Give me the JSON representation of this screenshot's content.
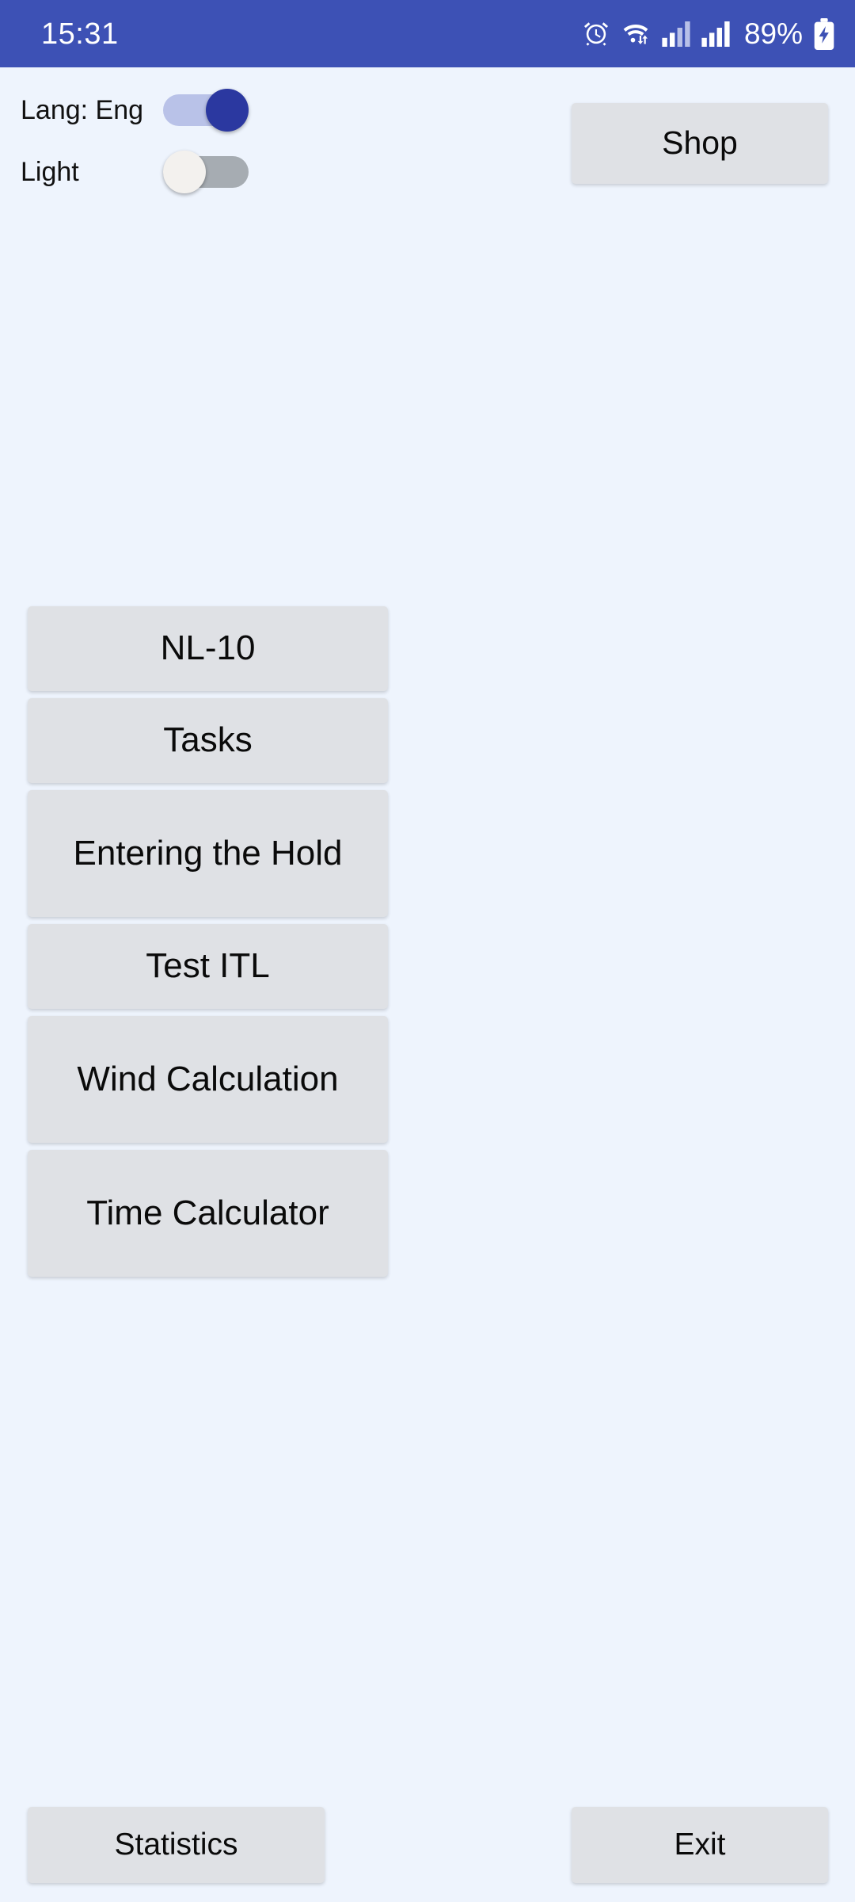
{
  "status_bar": {
    "clock": "15:31",
    "battery_percent": "89%",
    "background_color": "#3d51b5",
    "icons": [
      "alarm-clock-icon",
      "wifi-icon",
      "signal-bars-icon",
      "signal-bars-icon",
      "battery-charging-icon"
    ]
  },
  "settings": {
    "language_toggle": {
      "label": "Lang: Eng",
      "state": "on",
      "track_color": "#b9c2e8",
      "thumb_color": "#2b38a0"
    },
    "theme_toggle": {
      "label": "Light",
      "state": "off",
      "track_color": "#a6acb2",
      "thumb_color": "#f3f1ee"
    }
  },
  "header": {
    "shop_label": "Shop"
  },
  "menu": {
    "items": [
      {
        "label": "NL-10",
        "lines": 1
      },
      {
        "label": "Tasks",
        "lines": 1
      },
      {
        "label": "Entering the Hold",
        "lines": 2
      },
      {
        "label": "Test ITL",
        "lines": 1
      },
      {
        "label": "Wind Calculation",
        "lines": 2
      },
      {
        "label": "Time Calculator",
        "lines": 2
      }
    ]
  },
  "footer": {
    "statistics_label": "Statistics",
    "exit_label": "Exit"
  },
  "theme": {
    "page_background": "#eef4fd",
    "button_background": "#dfe1e5",
    "text_color": "#0a0a0a"
  }
}
